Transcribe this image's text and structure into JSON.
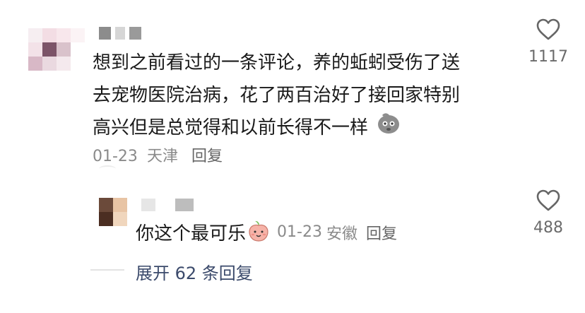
{
  "comment": {
    "text_line1": "想到之前看过的一条评论，养的蚯蚓受伤了送",
    "text_line2": "去宠物医院治病，花了两百治好了接回家特别",
    "text_line3": "高兴但是总觉得和以前长得不一样",
    "date": "01-23",
    "location": "天津",
    "reply_label": "回复",
    "like_count": "1117",
    "emoji": "sweat-face-emoji"
  },
  "reply": {
    "text": "你这个最可乐",
    "emoji": "peach-face-emoji",
    "date": "01-23",
    "location": "安徽",
    "reply_label": "回复",
    "like_count": "488"
  },
  "expand_label": "展开 62 条回复",
  "icons": {
    "like": "heart-outline-icon"
  },
  "colors": {
    "text": "#1a1a1a",
    "meta": "#8a8a8a",
    "link": "#3b4a6b"
  }
}
